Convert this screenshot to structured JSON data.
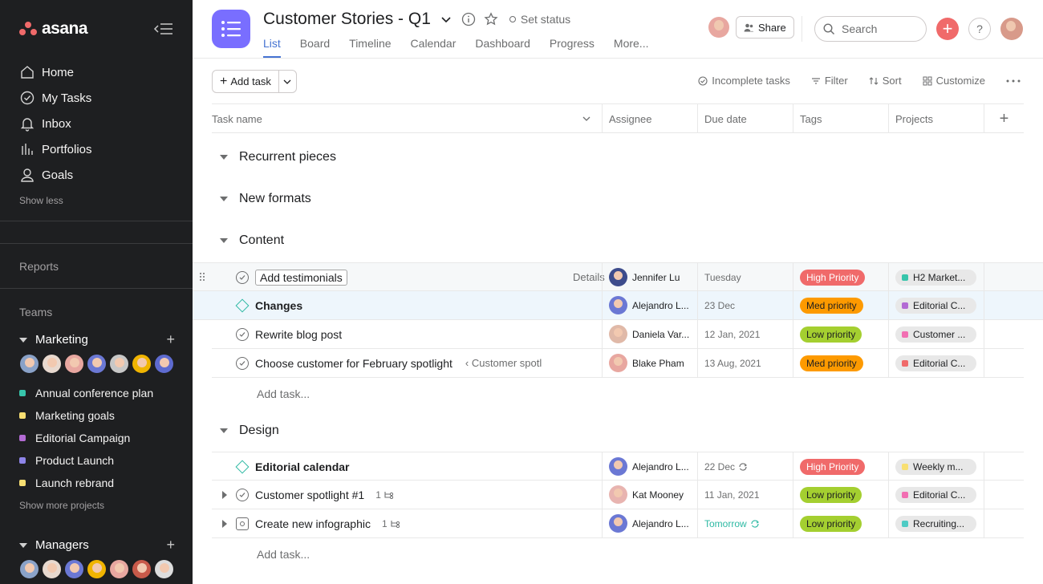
{
  "sidebar": {
    "logo": "asana",
    "nav": [
      {
        "label": "Home",
        "icon": "home-icon"
      },
      {
        "label": "My Tasks",
        "icon": "check-circle-icon"
      },
      {
        "label": "Inbox",
        "icon": "bell-icon"
      },
      {
        "label": "Portfolios",
        "icon": "bar-chart-icon"
      },
      {
        "label": "Goals",
        "icon": "person-icon"
      }
    ],
    "show_less": "Show less",
    "reports": "Reports",
    "teams": "Teams",
    "team_marketing": "Marketing",
    "projects": [
      {
        "label": "Annual conference plan",
        "color": "#37c5ab"
      },
      {
        "label": "Marketing goals",
        "color": "#f8df72"
      },
      {
        "label": "Editorial Campaign",
        "color": "#b36bd4"
      },
      {
        "label": "Product Launch",
        "color": "#8d84e8"
      },
      {
        "label": "Launch rebrand",
        "color": "#f8df72"
      }
    ],
    "show_more": "Show more projects",
    "team_managers": "Managers"
  },
  "header": {
    "title": "Customer Stories - Q1",
    "set_status": "Set status",
    "tabs": [
      "List",
      "Board",
      "Timeline",
      "Calendar",
      "Dashboard",
      "Progress",
      "More..."
    ],
    "share": "Share",
    "search_placeholder": "Search",
    "help": "?"
  },
  "toolbar": {
    "add_task": "Add task",
    "incomplete": "Incomplete tasks",
    "filter": "Filter",
    "sort": "Sort",
    "customize": "Customize"
  },
  "table": {
    "columns": [
      "Task name",
      "Assignee",
      "Due date",
      "Tags",
      "Projects"
    ],
    "add_task_row": "Add task...",
    "sections": [
      "Recurrent pieces",
      "New formats",
      "Content",
      "Design"
    ],
    "details": "Details",
    "rows": [
      {
        "name": "Add testimonials",
        "assignee": "Jennifer Lu",
        "due": "Tuesday",
        "tag": "High Priority",
        "tag_color": "#f06a6a",
        "project": "H2 Market...",
        "project_color": "#37c5ab"
      },
      {
        "name": "Changes",
        "assignee": "Alejandro L...",
        "due": "23 Dec",
        "tag": "Med priority",
        "tag_color": "#fd9a00",
        "project": "Editorial C...",
        "project_color": "#b36bd4"
      },
      {
        "name": "Rewrite blog post",
        "assignee": "Daniela Var...",
        "due": "12 Jan, 2021",
        "tag": "Low priority",
        "tag_color": "#a4cf30",
        "project": "Customer ...",
        "project_color": "#f26fb2"
      },
      {
        "name": "Choose customer for February spotlight",
        "crumb": "‹ Customer spotl",
        "assignee": "Blake Pham",
        "due": "13 Aug, 2021",
        "tag": "Med priority",
        "tag_color": "#fd9a00",
        "project": "Editorial C...",
        "project_color": "#f06a6a"
      },
      {
        "name": "Editorial calendar",
        "assignee": "Alejandro L...",
        "due": "22 Dec",
        "tag": "High Priority",
        "tag_color": "#f06a6a",
        "project": "Weekly m...",
        "project_color": "#f8df72"
      },
      {
        "name": "Customer spotlight #1",
        "subtasks": "1",
        "assignee": "Kat Mooney",
        "due": "11 Jan, 2021",
        "tag": "Low priority",
        "tag_color": "#a4cf30",
        "project": "Editorial C...",
        "project_color": "#f26fb2"
      },
      {
        "name": "Create new infographic",
        "subtasks": "1",
        "assignee": "Alejandro L...",
        "due": "Tomorrow",
        "tag": "Low priority",
        "tag_color": "#a4cf30",
        "project": "Recruiting...",
        "project_color": "#4ecbc4"
      }
    ]
  }
}
